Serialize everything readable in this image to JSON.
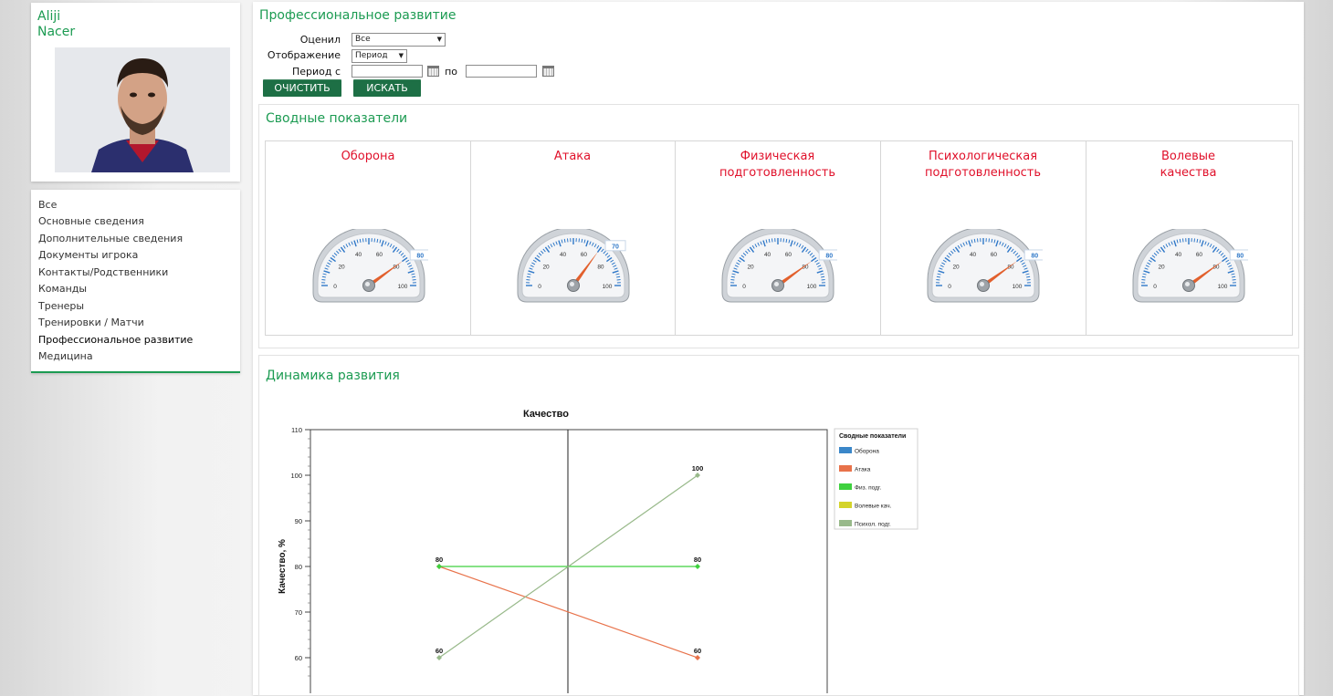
{
  "player": {
    "first_name": "Aliji",
    "last_name": "Nacer"
  },
  "nav": {
    "items": [
      {
        "label": "Все"
      },
      {
        "label": "Основные сведения"
      },
      {
        "label": "Дополнительные сведения"
      },
      {
        "label": "Документы игрока"
      },
      {
        "label": "Контакты/Родственники"
      },
      {
        "label": "Команды"
      },
      {
        "label": "Тренеры"
      },
      {
        "label": "Тренировки / Матчи"
      },
      {
        "label": "Профессиональное развитие"
      },
      {
        "label": "Медицина"
      }
    ],
    "active_index": 8
  },
  "page": {
    "title": "Профессиональное развитие"
  },
  "filters": {
    "evaluator_label": "Оценил",
    "evaluator_value": "Все",
    "display_label": "Отображение",
    "display_value": "Период",
    "period_label": "Период с",
    "period_to_label": "по",
    "period_from_value": "",
    "period_to_value": "",
    "clear_button": "ОЧИСТИТЬ",
    "search_button": "ИСКАТЬ"
  },
  "summary": {
    "title": "Сводные показатели",
    "gauges": [
      {
        "title_line1": "Оборона",
        "title_line2": "",
        "value": 80
      },
      {
        "title_line1": "Атака",
        "title_line2": "",
        "value": 70
      },
      {
        "title_line1": "Физическая",
        "title_line2": "подготовленность",
        "value": 80
      },
      {
        "title_line1": "Психологическая",
        "title_line2": "подготовленность",
        "value": 80
      },
      {
        "title_line1": "Волевые",
        "title_line2": "качества",
        "value": 80
      }
    ],
    "gauge_scale": {
      "min": 0,
      "max": 100,
      "ticks": [
        "0",
        "20",
        "40",
        "60",
        "80",
        "100"
      ]
    },
    "colors": {
      "needle": "#e2602d",
      "ticks": "#2f78c8",
      "title": "#e0102a"
    }
  },
  "dynamics": {
    "title": "Динамика развития",
    "chart_data": {
      "type": "line",
      "title": "Качество",
      "ylabel": "Качество, %",
      "xlabel": "",
      "ylim_visible": [
        55,
        110
      ],
      "y_ticks": [
        60,
        70,
        80,
        90,
        100,
        110
      ],
      "x_count": 2,
      "legend_title": "Сводные показатели",
      "legend_position": "right",
      "series": [
        {
          "name": "Оборона",
          "color": "#3a87c9",
          "values": []
        },
        {
          "name": "Атака",
          "color": "#e8724a",
          "values": [
            80,
            60
          ]
        },
        {
          "name": "Физ. подг.",
          "color": "#3ed13e",
          "values": [
            80,
            80
          ]
        },
        {
          "name": "Волевые кач.",
          "color": "#d4d42a",
          "values": []
        },
        {
          "name": "Психол. подг.",
          "color": "#98b98a",
          "values": [
            60,
            100
          ]
        }
      ],
      "point_labels": [
        {
          "label": "80",
          "series": 1,
          "index": 0
        },
        {
          "label": "60",
          "series": 1,
          "index": 1
        },
        {
          "label": "80",
          "series": 2,
          "index": 1
        },
        {
          "label": "60",
          "series": 4,
          "index": 0
        },
        {
          "label": "100",
          "series": 4,
          "index": 1
        }
      ]
    }
  }
}
